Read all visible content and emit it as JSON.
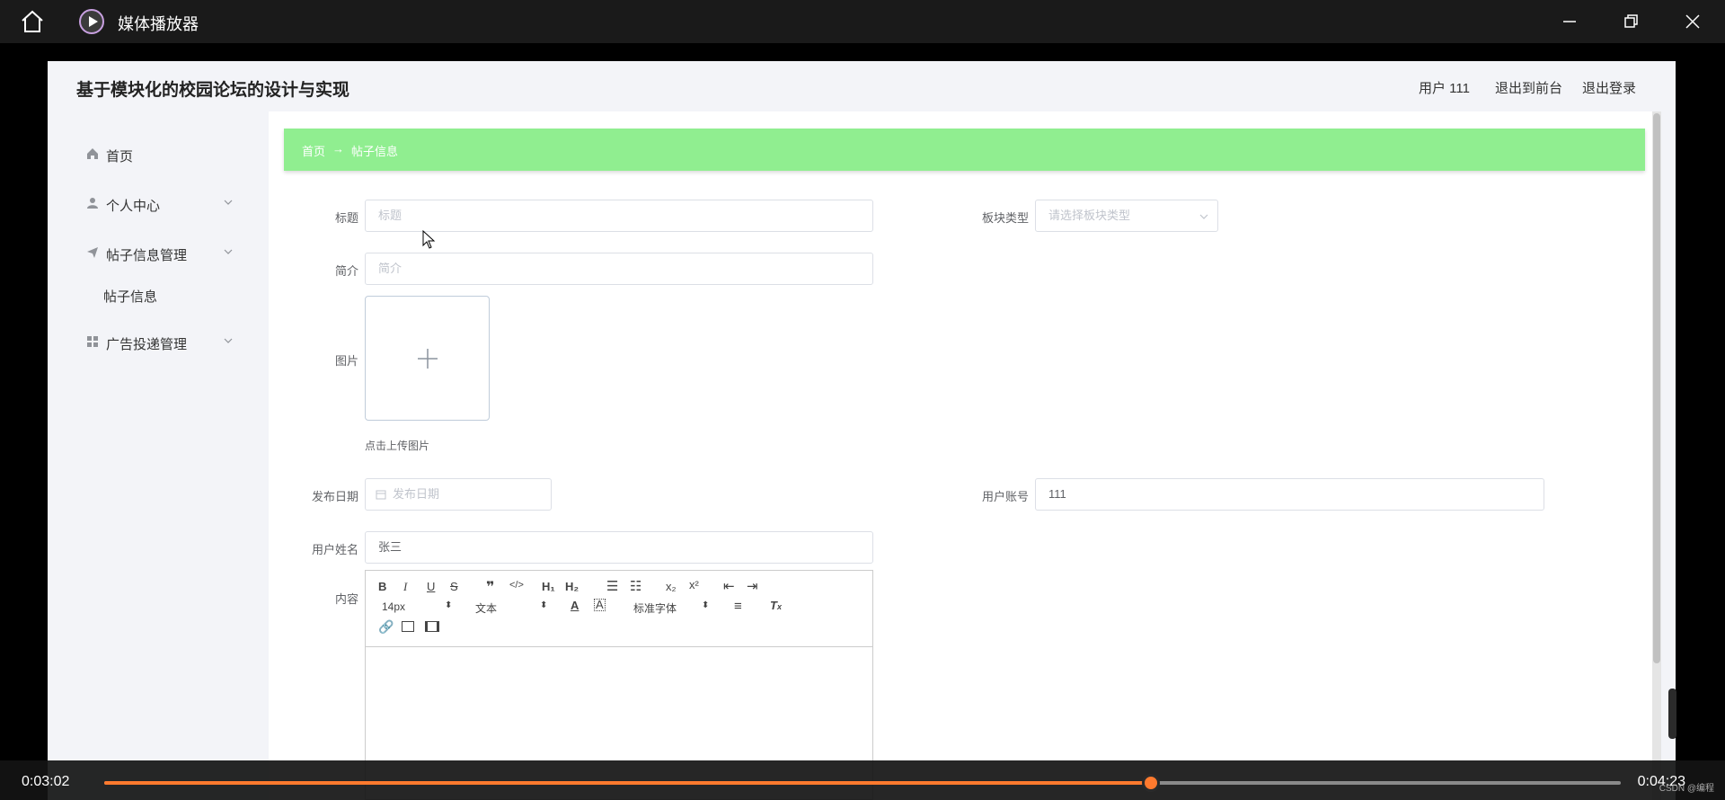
{
  "window": {
    "title": "媒体播放器"
  },
  "header": {
    "title": "基于模块化的校园论坛的设计与实现",
    "user": "用户 111",
    "to_front": "退出到前台",
    "logout": "退出登录"
  },
  "sidebar": {
    "items": [
      {
        "label": "首页",
        "icon": "home-icon"
      },
      {
        "label": "个人中心",
        "icon": "user-icon"
      },
      {
        "label": "帖子信息管理",
        "icon": "send-icon"
      },
      {
        "label": "帖子信息",
        "icon": ""
      },
      {
        "label": "广告投递管理",
        "icon": "grid-icon"
      }
    ]
  },
  "breadcrumb": {
    "home": "首页",
    "arrow": "→",
    "current": "帖子信息"
  },
  "form": {
    "title": {
      "label": "标题",
      "placeholder": "标题"
    },
    "category": {
      "label": "板块类型",
      "placeholder": "请选择板块类型"
    },
    "intro": {
      "label": "简介",
      "placeholder": "简介"
    },
    "image": {
      "label": "图片",
      "tip": "点击上传图片"
    },
    "publish_date": {
      "label": "发布日期",
      "placeholder": "发布日期"
    },
    "account": {
      "label": "用户账号",
      "value": "111"
    },
    "name": {
      "label": "用户姓名",
      "value": "张三"
    },
    "content": {
      "label": "内容"
    }
  },
  "editor": {
    "font_size": "14px",
    "block": "文本",
    "font": "标准字体"
  },
  "player": {
    "current": "0:03:02",
    "total": "0:04:23",
    "progress": 0.69,
    "watermark": "CSDN @编程"
  }
}
